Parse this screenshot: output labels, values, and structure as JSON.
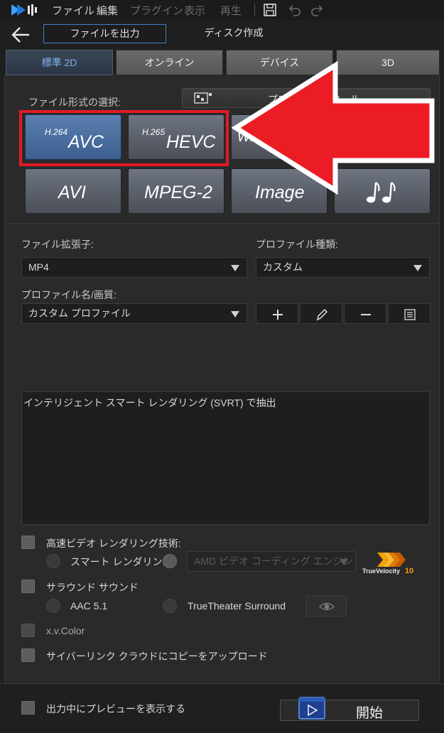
{
  "menu": {
    "items": [
      "ファイル",
      "編集",
      "プラグイン",
      "表示",
      "再生"
    ],
    "disabled": [
      false,
      false,
      true,
      true,
      true
    ]
  },
  "icons": [
    "app-logo",
    "save-icon",
    "undo-icon",
    "redo-icon",
    "back-arrow-icon",
    "profile-tool-icon",
    "note-icon",
    "plus-icon",
    "pencil-icon",
    "minus-icon",
    "list-icon",
    "eye-icon",
    "play-icon"
  ],
  "header": {
    "tabs": [
      "ファイルを出力",
      "ディスク作成"
    ],
    "active_tab": 0
  },
  "main_tabs": {
    "labels": [
      "標準 2D",
      "オンライン",
      "デバイス",
      "3D"
    ],
    "active": 0
  },
  "format_section": {
    "label": "ファイル形式の選択:",
    "profile_tool_label": "プロファイル ツール",
    "buttons": [
      {
        "sup": "H.264",
        "main": "AVC",
        "selected": true
      },
      {
        "sup": "H.265",
        "main": "HEVC",
        "selected": false
      },
      {
        "sup": "",
        "main": "WMV",
        "selected": false
      },
      {
        "sup": "",
        "main": "AVI",
        "selected": false
      },
      {
        "sup": "",
        "main": "MPEG-2",
        "selected": false
      },
      {
        "sup": "",
        "main": "Image",
        "selected": false
      }
    ]
  },
  "settings": {
    "ext_label": "ファイル拡張子:",
    "ext_value": "MP4",
    "type_label": "プロファイル種類:",
    "type_value": "カスタム",
    "name_label": "プロファイル名/画質:",
    "name_value": "カスタム プロファイル"
  },
  "svrt_text": "インテリジェント スマート レンダリング (SVRT) で抽出",
  "options": {
    "fast_render": "高速ビデオ レンダリング技術:",
    "smart_render": "スマート レンダリン…",
    "amd_engine": "AMD ビデオ コーディング エンジン",
    "truevelocity": "TrueVelocity",
    "truevelocity_ver": "10",
    "surround": "サラウンド サウンド",
    "aac": "AAC 5.1",
    "truetheater": "TrueTheater Surround",
    "xvcolor": "x.v.Color",
    "cyberlink_cloud": "サイバーリンク クラウドにコピーをアップロード"
  },
  "footer": {
    "preview_label": "出力中にプレビューを表示する",
    "start_label": "開始"
  },
  "colors": {
    "accent_blue": "#3f7fc8",
    "highlight_red": "#e01a24",
    "arrow_red": "#ec1c24"
  }
}
